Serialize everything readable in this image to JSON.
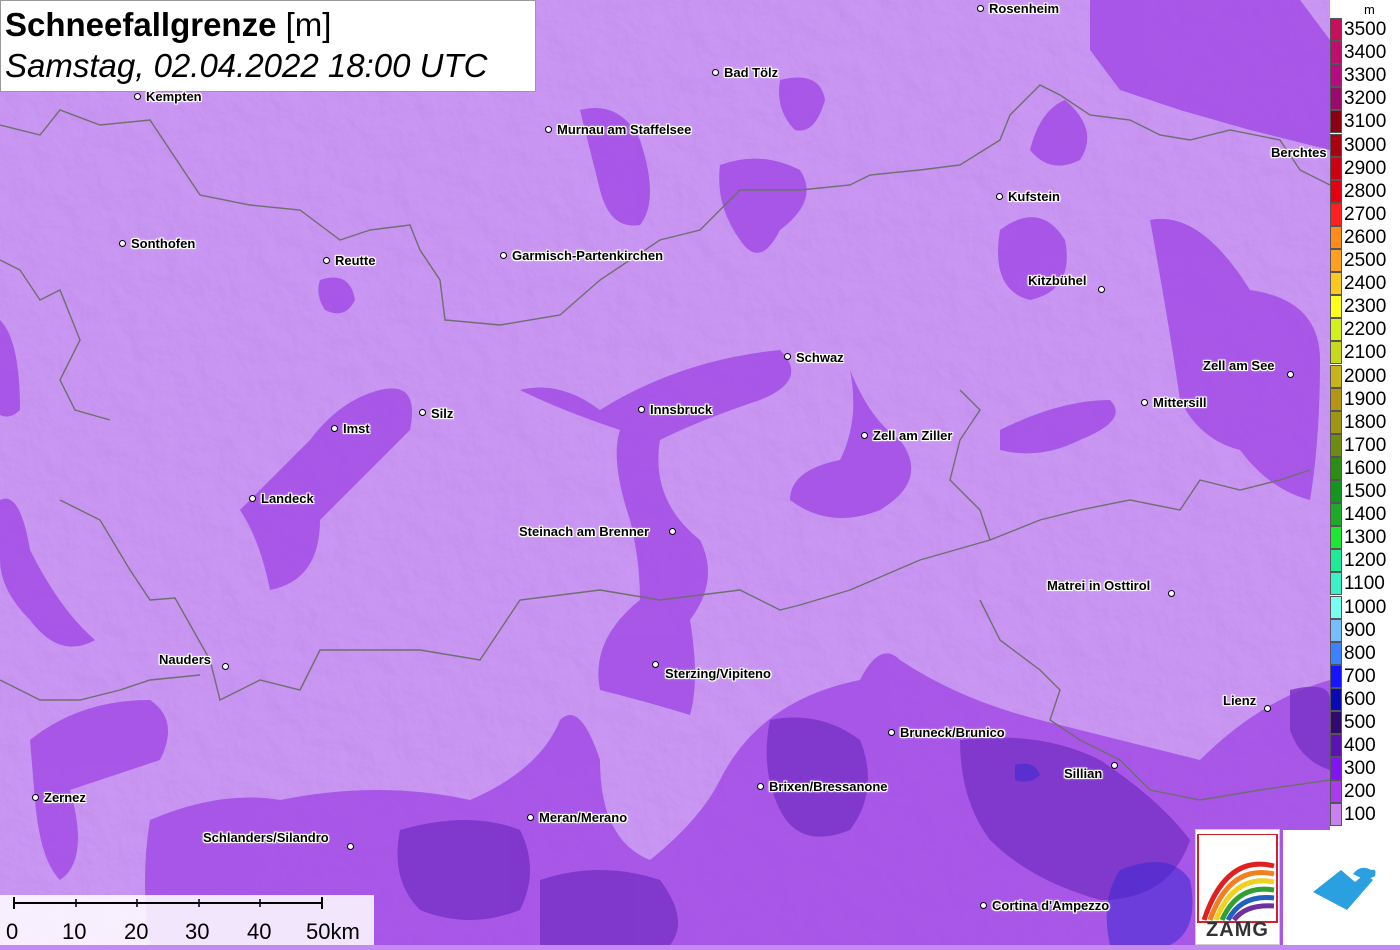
{
  "title": {
    "main": "Schneefallgrenze",
    "unit": "[m]",
    "subtitle": "Samstag, 02.04.2022 18:00 UTC"
  },
  "cities": [
    {
      "name": "Rosenheim",
      "key": "rosenheim"
    },
    {
      "name": "Bad Tölz",
      "key": "bad-toelz"
    },
    {
      "name": "Kempten",
      "key": "kempten"
    },
    {
      "name": "Murnau am Staffelsee",
      "key": "murnau"
    },
    {
      "name": "Berchtes",
      "key": "berchtesgaden"
    },
    {
      "name": "Kufstein",
      "key": "kufstein"
    },
    {
      "name": "Sonthofen",
      "key": "sonthofen"
    },
    {
      "name": "Reutte",
      "key": "reutte"
    },
    {
      "name": "Garmisch-Partenkirchen",
      "key": "garmisch"
    },
    {
      "name": "Kitzbühel",
      "key": "kitzbuehel"
    },
    {
      "name": "Schwaz",
      "key": "schwaz"
    },
    {
      "name": "Zell am See",
      "key": "zell-am-see"
    },
    {
      "name": "Mittersill",
      "key": "mittersill"
    },
    {
      "name": "Silz",
      "key": "silz"
    },
    {
      "name": "Innsbruck",
      "key": "innsbruck"
    },
    {
      "name": "Imst",
      "key": "imst"
    },
    {
      "name": "Zell am Ziller",
      "key": "zell-am-ziller"
    },
    {
      "name": "Landeck",
      "key": "landeck"
    },
    {
      "name": "Steinach am Brenner",
      "key": "steinach"
    },
    {
      "name": "Matrei in Osttirol",
      "key": "matrei"
    },
    {
      "name": "Nauders",
      "key": "nauders"
    },
    {
      "name": "Sterzing/Vipiteno",
      "key": "sterzing"
    },
    {
      "name": "Lienz",
      "key": "lienz"
    },
    {
      "name": "Bruneck/Brunico",
      "key": "bruneck"
    },
    {
      "name": "Sillian",
      "key": "sillian"
    },
    {
      "name": "Brixen/Bressanone",
      "key": "brixen"
    },
    {
      "name": "Zernez",
      "key": "zernez"
    },
    {
      "name": "Meran/Merano",
      "key": "meran"
    },
    {
      "name": "Schlanders/Silandro",
      "key": "schlanders"
    },
    {
      "name": "Cortina d'Ampezzo",
      "key": "cortina"
    }
  ],
  "legend": {
    "unit": "m",
    "items": [
      {
        "label": "3500",
        "color": "#c8105a"
      },
      {
        "label": "3400",
        "color": "#be0e6e"
      },
      {
        "label": "3300",
        "color": "#b40c80"
      },
      {
        "label": "3200",
        "color": "#9a0a6a"
      },
      {
        "label": "3100",
        "color": "#8a0010"
      },
      {
        "label": "3000",
        "color": "#aa0010"
      },
      {
        "label": "2900",
        "color": "#cc0010"
      },
      {
        "label": "2800",
        "color": "#e40010"
      },
      {
        "label": "2700",
        "color": "#ff2020"
      },
      {
        "label": "2600",
        "color": "#ff8c1a"
      },
      {
        "label": "2500",
        "color": "#ffa020"
      },
      {
        "label": "2400",
        "color": "#ffc820"
      },
      {
        "label": "2300",
        "color": "#ffff1a"
      },
      {
        "label": "2200",
        "color": "#d2f01a"
      },
      {
        "label": "2100",
        "color": "#c8d81a"
      },
      {
        "label": "2000",
        "color": "#c8b41a"
      },
      {
        "label": "1900",
        "color": "#b49614"
      },
      {
        "label": "1800",
        "color": "#a09614"
      },
      {
        "label": "1700",
        "color": "#6e8c14"
      },
      {
        "label": "1600",
        "color": "#2d8c14"
      },
      {
        "label": "1500",
        "color": "#14961e"
      },
      {
        "label": "1400",
        "color": "#1eaa28"
      },
      {
        "label": "1300",
        "color": "#1ee632"
      },
      {
        "label": "1200",
        "color": "#1eeb96"
      },
      {
        "label": "1100",
        "color": "#3cf0c8"
      },
      {
        "label": "1000",
        "color": "#78fff0"
      },
      {
        "label": "900",
        "color": "#78beff"
      },
      {
        "label": "800",
        "color": "#3c82ff"
      },
      {
        "label": "700",
        "color": "#1414ff"
      },
      {
        "label": "600",
        "color": "#0a0ab4"
      },
      {
        "label": "500",
        "color": "#320a6e"
      },
      {
        "label": "400",
        "color": "#5a14b4"
      },
      {
        "label": "300",
        "color": "#8214f0"
      },
      {
        "label": "200",
        "color": "#aa3cf0"
      },
      {
        "label": "100",
        "color": "#c882f0"
      }
    ]
  },
  "scalebar": {
    "labels": [
      "0",
      "10",
      "20",
      "30",
      "40",
      "50km"
    ]
  },
  "logos": {
    "zamg": "ZAMG"
  },
  "colors": {
    "base": "#c58af2",
    "mid": "#a450e6",
    "dark": "#7a32c8",
    "deep": "#5a28a0",
    "blue": "#3c28d2"
  }
}
